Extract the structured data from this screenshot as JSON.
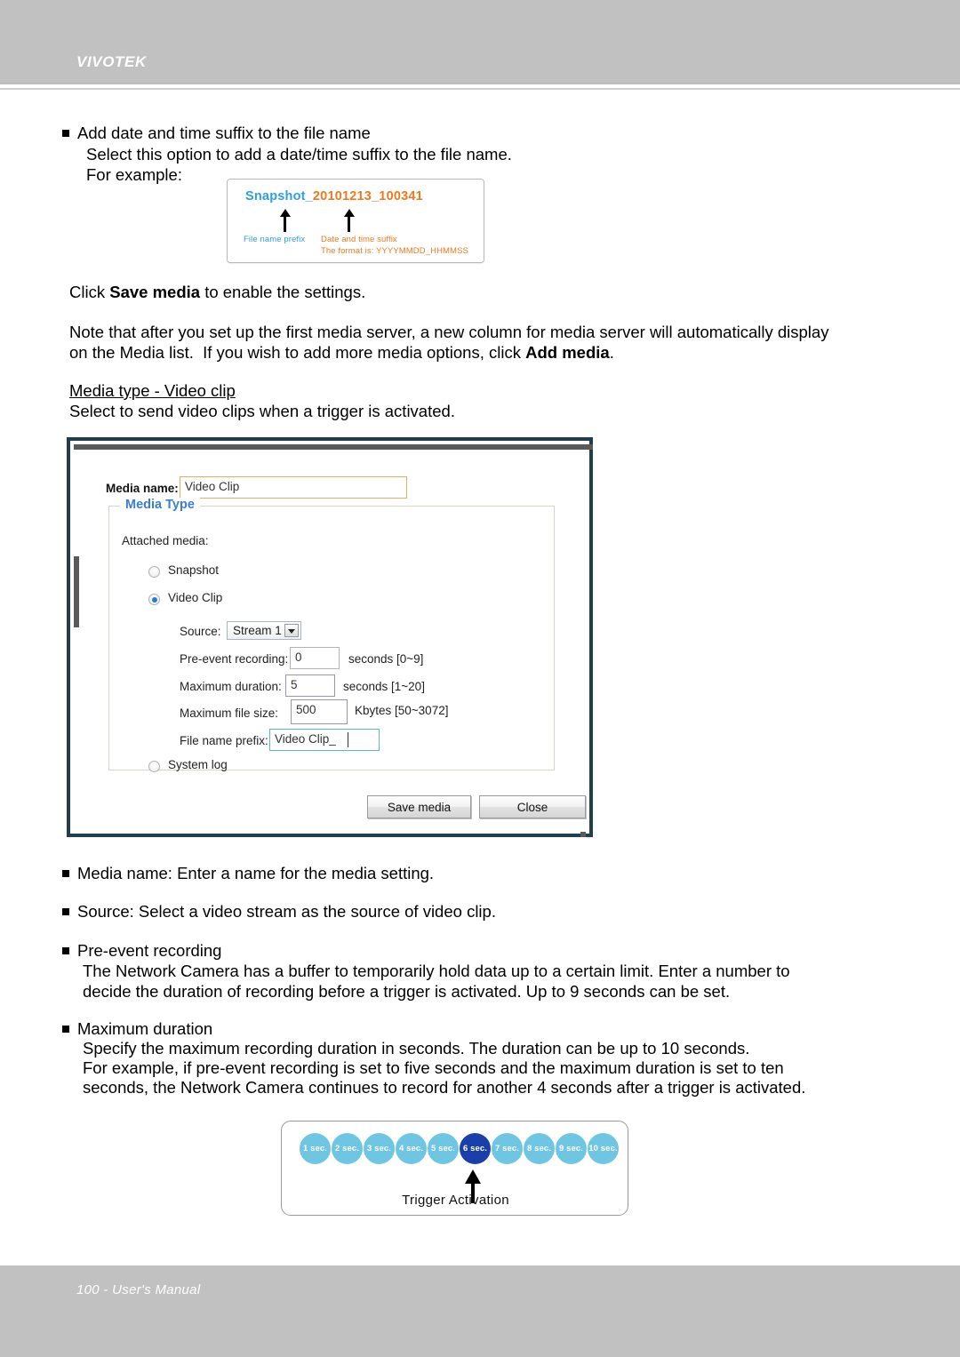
{
  "header": {
    "brand": "VIVOTEK"
  },
  "footer": {
    "text": "100 - User's Manual"
  },
  "body": {
    "b1_title": "Add date and time suffix to the file name",
    "b1_line1": "Select this option to add a date/time suffix to the file name.",
    "b1_line2": "For example:",
    "click_save_pre": "Click ",
    "click_save_bold": "Save media",
    "click_save_post": " to enable the settings.",
    "note_line1": "Note that after you set up the first media server, a new column for media server will automatically display",
    "note_line2_pre": "on the Media list.  If you wish to add more media options, click ",
    "note_line2_bold": "Add media",
    "note_line2_post": ".",
    "section_heading": "Media type - Video clip",
    "section_sub": "Select to send video clips when a trigger is activated.",
    "b2_text": "Media name: Enter a name for the media setting.",
    "b3_text": "Source: Select a video stream as the source of video clip.",
    "b4_title": "Pre-event recording",
    "b4_line1": "The Network Camera has a buffer to temporarily hold data up to a certain limit. Enter a number to",
    "b4_line2": "decide the duration of recording before a trigger is activated. Up to 9 seconds can be set.",
    "b5_title": "Maximum duration",
    "b5_line1": "Specify the maximum recording duration in seconds. The duration can be up to 10 seconds.",
    "b5_line2": "For example, if pre-event recording is set to five seconds and the maximum duration is set to ten",
    "b5_line3": "seconds, the Network Camera continues to record for another 4 seconds after a trigger is activated."
  },
  "snapshot_figure": {
    "filename_prefix": "Snapshot_",
    "filename_suffix": "20101213_100341",
    "label_prefix": "File name prefix",
    "label_suffix": "Date and time suffix",
    "label_format": "The format is: YYYYMMDD_HHMMSS",
    "prefix_color": "#2e9fe0",
    "suffix_color": "#ef7a1e"
  },
  "dialog": {
    "media_name_label": "Media name:",
    "media_name_value": "Video Clip",
    "legend": "Media Type",
    "attached_media_label": "Attached media:",
    "radio_snapshot": "Snapshot",
    "radio_video_clip": "Video Clip",
    "radio_system_log": "System log",
    "selected_radio": "Video Clip",
    "source_label": "Source:",
    "source_value": "Stream 1",
    "preevent_label": "Pre-event recording:",
    "preevent_value": "0",
    "preevent_units": "seconds [0~9]",
    "maxduration_label": "Maximum duration:",
    "maxduration_value": "5",
    "maxduration_units": "seconds [1~20]",
    "maxfilesize_label": "Maximum file size:",
    "maxfilesize_value": "500",
    "maxfilesize_units": "Kbytes [50~3072]",
    "prefix_label": "File name prefix:",
    "prefix_value": "Video Clip_",
    "save_button": "Save media",
    "close_button": "Close",
    "accent_color": "#3a7fd0"
  },
  "timeline_figure": {
    "caption": "Trigger Activation",
    "active_index": 5,
    "active_color": "#1a3faa",
    "inactive_color": "#6ec6e3",
    "segments": [
      "1 sec.",
      "2 sec.",
      "3 sec.",
      "4 sec.",
      "5 sec.",
      "6 sec.",
      "7 sec.",
      "8 sec.",
      "9 sec.",
      "10 sec."
    ]
  }
}
